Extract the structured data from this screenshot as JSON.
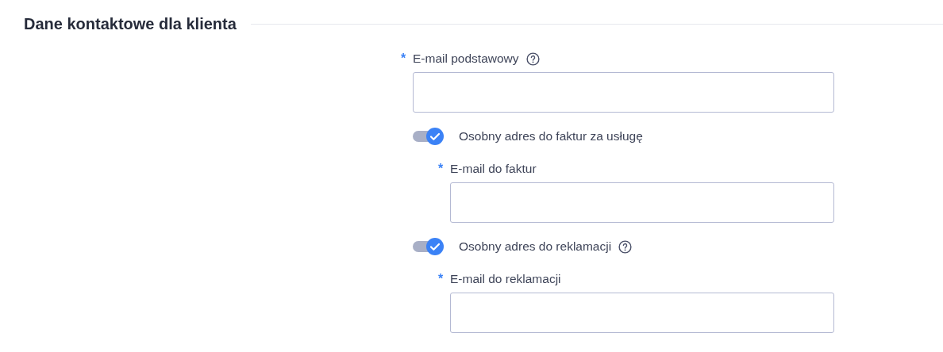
{
  "section": {
    "title": "Dane kontaktowe dla klienta"
  },
  "primary_email": {
    "label": "E-mail podstawowy",
    "required_mark": "*",
    "help": true
  },
  "options": [
    {
      "label": "Osobny adres do faktur za usługę",
      "on": true,
      "help": false,
      "field": {
        "label": "E-mail do faktur",
        "required_mark": "*"
      }
    },
    {
      "label": "Osobny adres do reklamacji",
      "on": true,
      "help": true,
      "field": {
        "label": "E-mail do reklamacji",
        "required_mark": "*"
      }
    }
  ]
}
